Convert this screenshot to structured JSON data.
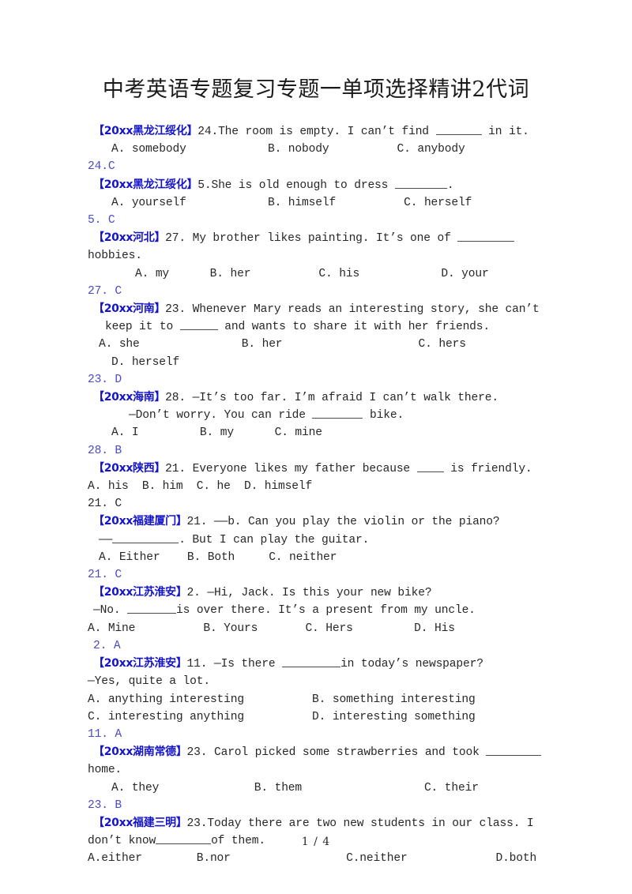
{
  "document": {
    "title": "中考英语专题复习专题一单项选择精讲2代词",
    "page_footer": "1 / 4",
    "colors": {
      "source_tag_blue": "#1414c8",
      "answer_blue": "#4b4bc4",
      "body_text": "#272727"
    }
  },
  "questions": [
    {
      "source": "【20xx黑龙江绥化】",
      "stem_a": "24.The room is empty. I can’t find ",
      "stem_b": " in it.",
      "options_line1": "A. somebody            B. nobody          C. anybody",
      "answer": "24.C"
    },
    {
      "source": "【20xx黑龙江绥化】",
      "stem_a": "5.She is old enough to dress ",
      "stem_b": ".",
      "options_line1": "A. yourself            B. himself          C. herself",
      "answer": "5. C"
    },
    {
      "source": "【20xx河北】",
      "stem_a": "27. My brother likes painting. It’s one of ",
      "stem_b": "",
      "stem_cont": "hobbies.",
      "options_line1": "A. my      B. her          C. his            D. your",
      "answer": "27. C"
    },
    {
      "source": "【20xx河南】",
      "stem_a": "23. Whenever Mary reads an interesting story, she can’t",
      "stem_cont_a": "keep it to ",
      "stem_cont_b": " and wants to share it with her friends.",
      "options_line1": "A. she               B. her                    C. hers",
      "options_line2": "D. herself",
      "answer": "23. D"
    },
    {
      "source": "【20xx海南】",
      "stem_a": "28. —It’s too far. I’m afraid I can’t walk there.",
      "stem_cont_a": "—Don’t worry. You can ride ",
      "stem_cont_b": " bike.",
      "options_line1": "A. I         B. my      C. mine",
      "answer": "28. B"
    },
    {
      "source": "【20xx陕西】",
      "stem_a": "21. Everyone likes my father because ",
      "stem_b": " is friendly.",
      "options_line1": "A. his  B. him  C. he  D. himself",
      "answer": "21. C",
      "answer_color": "body"
    },
    {
      "source": "【20xx福建厦门】",
      "stem_a": "21. ——b. Can you play the violin or the piano?",
      "stem_cont_a": "——",
      "stem_cont_b": ". But I can play the guitar.",
      "options_line1": "A. Either    B. Both     C. neither",
      "answer": "21. C"
    },
    {
      "source": "【20xx江苏淮安】",
      "stem_a": "2. —Hi, Jack. Is this your new bike?",
      "stem_cont_a": "—No. ",
      "stem_cont_b": "is over there. It’s a present from my uncle.",
      "options_line1": "A. Mine          B. Yours       C. Hers         D. His",
      "answer": "2. A"
    },
    {
      "source": "【20xx江苏淮安】",
      "stem_a": "11. —Is there ",
      "stem_b": "in today’s newspaper?",
      "stem_cont": "—Yes, quite a lot.",
      "options_line1": "A. anything interesting          B. something interesting",
      "options_line2": "C. interesting anything          D. interesting something",
      "answer": "11. A"
    },
    {
      "source": "【20xx湖南常德】",
      "stem_a": "23. Carol picked some strawberries and took ",
      "stem_b": "",
      "stem_cont": "home.",
      "options_line1": "A. they              B. them                  C. their",
      "answer": "23. B"
    },
    {
      "source": "【20xx福建三明】",
      "stem_a": "23.Today there are two new students in our class. I",
      "stem_cont_a": "don’t know",
      "stem_cont_b": "of them.",
      "options_line1": "A.either        B.nor                 C.neither             D.both",
      "answer": ""
    }
  ]
}
